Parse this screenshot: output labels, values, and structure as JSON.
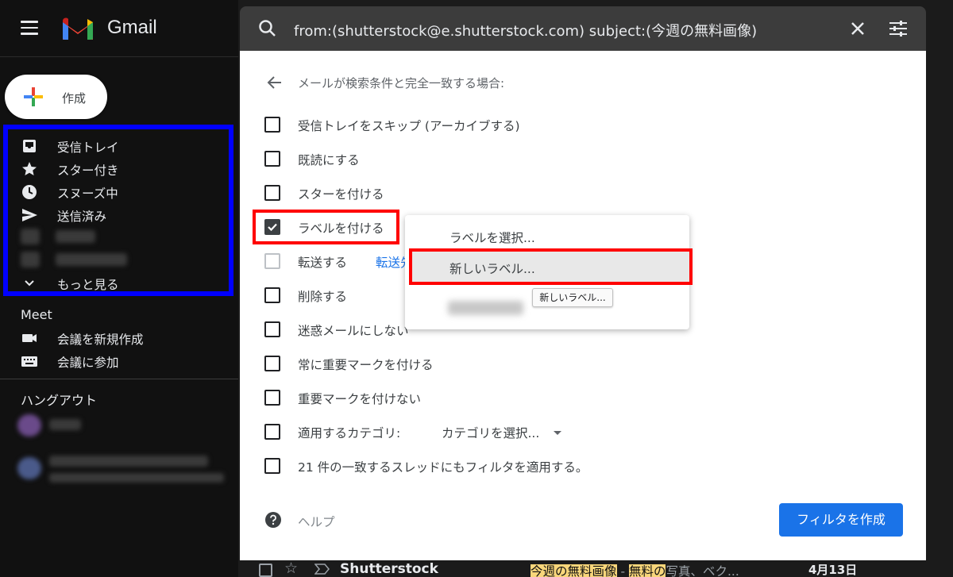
{
  "app": {
    "name": "Gmail"
  },
  "compose": {
    "label": "作成"
  },
  "sidebar": {
    "items": [
      {
        "label": "受信トレイ",
        "icon": "inbox-icon"
      },
      {
        "label": "スター付き",
        "icon": "star-icon"
      },
      {
        "label": "スヌーズ中",
        "icon": "clock-icon"
      },
      {
        "label": "送信済み",
        "icon": "send-icon"
      }
    ],
    "more_label": "もっと見る"
  },
  "meet": {
    "title": "Meet",
    "new_meeting": "会議を新規作成",
    "join_meeting": "会議に参加"
  },
  "hangouts": {
    "title": "ハングアウト"
  },
  "search": {
    "query": "from:(shutterstock@e.shutterstock.com) subject:(今週の無料画像)"
  },
  "filter": {
    "heading": "メールが検索条件と完全一致する場合:",
    "options": [
      {
        "label": "受信トレイをスキップ (アーカイブする)",
        "checked": false
      },
      {
        "label": "既読にする",
        "checked": false
      },
      {
        "label": "スターを付ける",
        "checked": false
      },
      {
        "label": "ラベルを付ける",
        "checked": true
      },
      {
        "label": "転送する",
        "checked": false,
        "disabled": true,
        "link": "転送先"
      },
      {
        "label": "削除する",
        "checked": false
      },
      {
        "label": "迷惑メールにしない",
        "checked": false
      },
      {
        "label": "常に重要マークを付ける",
        "checked": false
      },
      {
        "label": "重要マークを付けない",
        "checked": false
      },
      {
        "label": "適用するカテゴリ:",
        "checked": false,
        "dropdown": "カテゴリを選択..."
      },
      {
        "label": "21 件の一致するスレッドにもフィルタを適用する。",
        "checked": false
      }
    ],
    "help_label": "ヘルプ",
    "create_label": "フィルタを作成"
  },
  "label_menu": {
    "choose": "ラベルを選択...",
    "new": "新しいラベル...",
    "tooltip": "新しいラベル..."
  },
  "mail_row": {
    "sender": "Shutterstock",
    "subject_highlight": "今週の無料画像",
    "separator": " - ",
    "snippet_highlight": "無料の",
    "snippet": "写真、ベク...",
    "date": "4月13日"
  },
  "colors": {
    "primary": "#1a73e8",
    "annotation_red": "#ff0000",
    "annotation_blue": "#0000ff",
    "background": "#111111"
  }
}
